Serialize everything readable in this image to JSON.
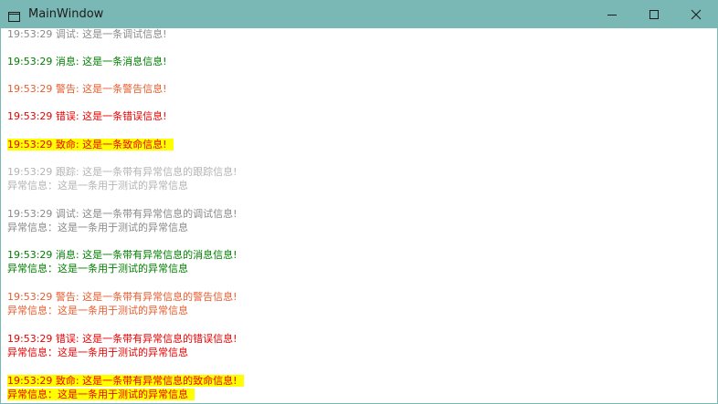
{
  "window": {
    "title": "MainWindow",
    "app_icon": "window-icon",
    "controls": {
      "minimize_icon": "minimize-icon",
      "maximize_icon": "maximize-icon",
      "close_icon": "close-icon"
    },
    "titlebar_color": "#7ab8b5"
  },
  "log": {
    "colors": {
      "debug": "#8a8a8a",
      "info": "#008000",
      "warn": "#ea5d2f",
      "error": "#ee0000",
      "fatal": "#ee0000",
      "trace": "#b4b4b4",
      "highlight": "#ffff00"
    },
    "lines": [
      "19:53:29 调试: 这是一条调试信息!",
      "19:53:29 消息: 这是一条消息信息!",
      "19:53:29 警告: 这是一条警告信息!",
      "19:53:29 错误: 这是一条错误信息!",
      "19:53:29 致命: 这是一条致命信息!",
      "19:53:29 跟踪: 这是一条带有异常信息的跟踪信息!",
      "异常信息：这是一条用于测试的异常信息",
      "19:53:29 调试: 这是一条带有异常信息的调试信息!",
      "异常信息：这是一条用于测试的异常信息",
      "19:53:29 消息: 这是一条带有异常信息的消息信息!",
      "异常信息：这是一条用于测试的异常信息",
      "19:53:29 警告: 这是一条带有异常信息的警告信息!",
      "异常信息：这是一条用于测试的异常信息",
      "19:53:29 错误: 这是一条带有异常信息的错误信息!",
      "异常信息：这是一条用于测试的异常信息",
      "19:53:29 致命: 这是一条带有异常信息的致命信息!",
      "异常信息：这是一条用于测试的异常信息"
    ]
  }
}
